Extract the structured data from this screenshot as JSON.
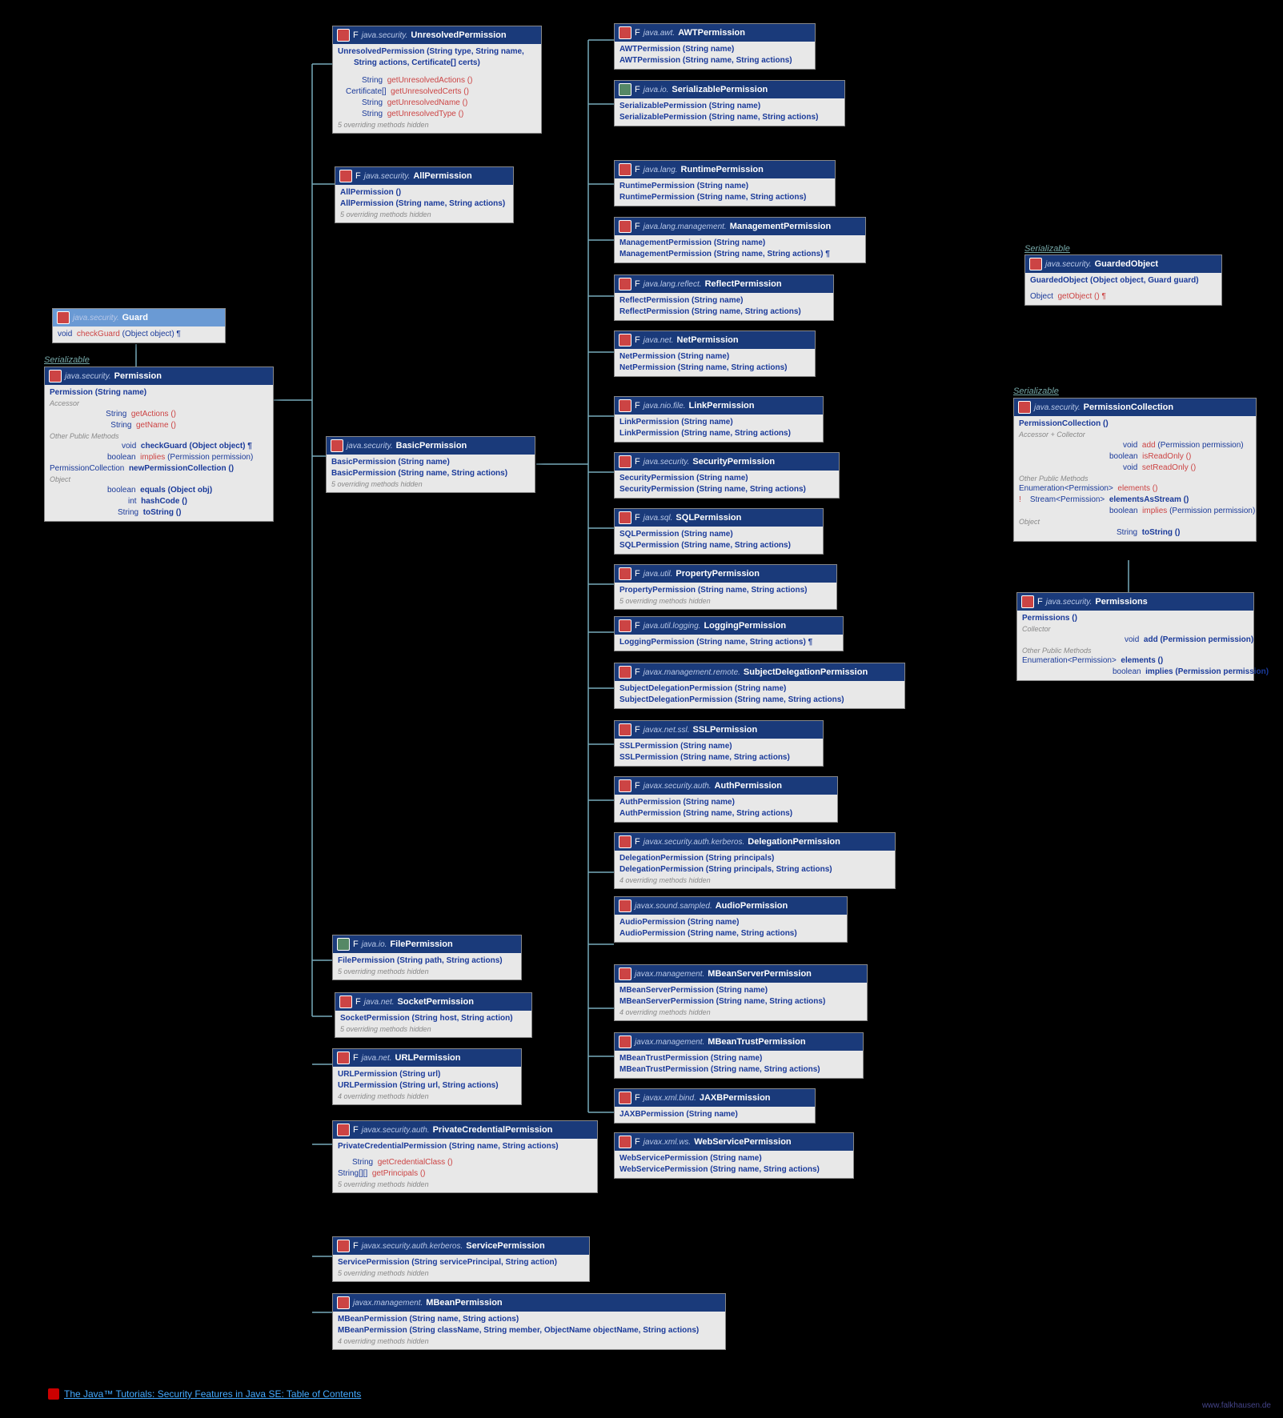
{
  "labels": {
    "ser": "Serializable"
  },
  "guard": {
    "pkg": "java.security.",
    "cls": "Guard",
    "m1": "void",
    "m1n": "checkGuard",
    "m1a": "(Object object) ¶"
  },
  "perm": {
    "pkg": "java.security.",
    "cls": "Permission",
    "c1": "Permission (String name)",
    "acc": "Accessor",
    "r1t": "String",
    "r1n": "getActions ()",
    "r2t": "String",
    "r2n": "getName ()",
    "opm": "Other Public Methods",
    "r3t": "void",
    "r3n": "checkGuard (Object object) ¶",
    "r4t": "boolean",
    "r4n": "implies",
    "r4a": "(Permission permission)",
    "r5t": "PermissionCollection",
    "r5n": "newPermissionCollection ()",
    "obj": "Object",
    "r6t": "boolean",
    "r6n": "equals (Object obj)",
    "r7t": "int",
    "r7n": "hashCode ()",
    "r8t": "String",
    "r8n": "toString ()"
  },
  "unres": {
    "pkg": "java.security.",
    "cls": "UnresolvedPermission",
    "c1": "UnresolvedPermission (String type, String name,",
    "c2": "String actions, Certificate[] certs)",
    "r1t": "String",
    "r1n": "getUnresolvedActions ()",
    "r2t": "Certificate[]",
    "r2n": "getUnresolvedCerts ()",
    "r3t": "String",
    "r3n": "getUnresolvedName ()",
    "r4t": "String",
    "r4n": "getUnresolvedType ()",
    "h": "5 overriding methods hidden"
  },
  "allp": {
    "pkg": "java.security.",
    "cls": "AllPermission",
    "c1": "AllPermission ()",
    "c2": "AllPermission (String name, String actions)",
    "h": "5 overriding methods hidden"
  },
  "basic": {
    "pkg": "java.security.",
    "cls": "BasicPermission",
    "c1": "BasicPermission (String name)",
    "c2": "BasicPermission (String name, String actions)",
    "h": "5 overriding methods hidden"
  },
  "filep": {
    "pkg": "java.io.",
    "cls": "FilePermission",
    "c1": "FilePermission (String path, String actions)",
    "h": "5 overriding methods hidden"
  },
  "sockp": {
    "pkg": "java.net.",
    "cls": "SocketPermission",
    "c1": "SocketPermission (String host, String action)",
    "h": "5 overriding methods hidden"
  },
  "urlp": {
    "pkg": "java.net.",
    "cls": "URLPermission",
    "c1": "URLPermission (String url)",
    "c2": "URLPermission (String url, String actions)",
    "h": "4 overriding methods hidden"
  },
  "privp": {
    "pkg": "javax.security.auth.",
    "cls": "PrivateCredentialPermission",
    "c1": "PrivateCredentialPermission (String name, String actions)",
    "r1t": "String",
    "r1n": "getCredentialClass ()",
    "r2t": "String[][]",
    "r2n": "getPrincipals ()",
    "h": "5 overriding methods hidden"
  },
  "servp": {
    "pkg": "javax.security.auth.kerberos.",
    "cls": "ServicePermission",
    "c1": "ServicePermission (String servicePrincipal, String action)",
    "h": "5 overriding methods hidden"
  },
  "mbeanp": {
    "pkg": "javax.management.",
    "cls": "MBeanPermission",
    "c1": "MBeanPermission (String name, String actions)",
    "c2": "MBeanPermission (String className, String member, ObjectName objectName, String actions)",
    "h": "4 overriding methods hidden"
  },
  "awt": {
    "pkg": "java.awt.",
    "cls": "AWTPermission",
    "c1": "AWTPermission (String name)",
    "c2": "AWTPermission (String name, String actions)"
  },
  "serp": {
    "pkg": "java.io.",
    "cls": "SerializablePermission",
    "c1": "SerializablePermission (String name)",
    "c2": "SerializablePermission (String name, String actions)"
  },
  "runp": {
    "pkg": "java.lang.",
    "cls": "RuntimePermission",
    "c1": "RuntimePermission (String name)",
    "c2": "RuntimePermission (String name, String actions)"
  },
  "mgmtp": {
    "pkg": "java.lang.management.",
    "cls": "ManagementPermission",
    "c1": "ManagementPermission (String name)",
    "c2": "ManagementPermission (String name, String actions) ¶"
  },
  "reflp": {
    "pkg": "java.lang.reflect.",
    "cls": "ReflectPermission",
    "c1": "ReflectPermission (String name)",
    "c2": "ReflectPermission (String name, String actions)"
  },
  "netp": {
    "pkg": "java.net.",
    "cls": "NetPermission",
    "c1": "NetPermission (String name)",
    "c2": "NetPermission (String name, String actions)"
  },
  "linkp": {
    "pkg": "java.nio.file.",
    "cls": "LinkPermission",
    "c1": "LinkPermission (String name)",
    "c2": "LinkPermission (String name, String actions)"
  },
  "secp": {
    "pkg": "java.security.",
    "cls": "SecurityPermission",
    "c1": "SecurityPermission (String name)",
    "c2": "SecurityPermission (String name, String actions)"
  },
  "sqlp": {
    "pkg": "java.sql.",
    "cls": "SQLPermission",
    "c1": "SQLPermission (String name)",
    "c2": "SQLPermission (String name, String actions)"
  },
  "propp": {
    "pkg": "java.util.",
    "cls": "PropertyPermission",
    "c1": "PropertyPermission (String name, String actions)",
    "h": "5 overriding methods hidden"
  },
  "logp": {
    "pkg": "java.util.logging.",
    "cls": "LoggingPermission",
    "c1": "LoggingPermission (String name, String actions) ¶"
  },
  "subjp": {
    "pkg": "javax.management.remote.",
    "cls": "SubjectDelegationPermission",
    "c1": "SubjectDelegationPermission (String name)",
    "c2": "SubjectDelegationPermission (String name, String actions)"
  },
  "sslp": {
    "pkg": "javax.net.ssl.",
    "cls": "SSLPermission",
    "c1": "SSLPermission (String name)",
    "c2": "SSLPermission (String name, String actions)"
  },
  "authp": {
    "pkg": "javax.security.auth.",
    "cls": "AuthPermission",
    "c1": "AuthPermission (String name)",
    "c2": "AuthPermission (String name, String actions)"
  },
  "delegp": {
    "pkg": "javax.security.auth.kerberos.",
    "cls": "DelegationPermission",
    "c1": "DelegationPermission (String principals)",
    "c2": "DelegationPermission (String principals, String actions)",
    "h": "4 overriding methods hidden"
  },
  "audp": {
    "pkg": "javax.sound.sampled.",
    "cls": "AudioPermission",
    "c1": "AudioPermission (String name)",
    "c2": "AudioPermission (String name, String actions)"
  },
  "mbsp": {
    "pkg": "javax.management.",
    "cls": "MBeanServerPermission",
    "c1": "MBeanServerPermission (String name)",
    "c2": "MBeanServerPermission (String name, String actions)",
    "h": "4 overriding methods hidden"
  },
  "mbtp": {
    "pkg": "javax.management.",
    "cls": "MBeanTrustPermission",
    "c1": "MBeanTrustPermission (String name)",
    "c2": "MBeanTrustPermission (String name, String actions)"
  },
  "jaxbp": {
    "pkg": "javax.xml.bind.",
    "cls": "JAXBPermission",
    "c1": "JAXBPermission (String name)"
  },
  "wsp": {
    "pkg": "javax.xml.ws.",
    "cls": "WebServicePermission",
    "c1": "WebServicePermission (String name)",
    "c2": "WebServicePermission (String name, String actions)"
  },
  "gobj": {
    "pkg": "java.security.",
    "cls": "GuardedObject",
    "c1": "GuardedObject (Object object, Guard guard)",
    "r1t": "Object",
    "r1n": "getObject () ¶"
  },
  "pcoll": {
    "pkg": "java.security.",
    "cls": "PermissionCollection",
    "c1": "PermissionCollection ()",
    "acc": "Accessor + Collector",
    "r1t": "void",
    "r1n": "add",
    "r1a": "(Permission permission)",
    "r2t": "boolean",
    "r2n": "isReadOnly ()",
    "r3t": "void",
    "r3n": "setReadOnly ()",
    "opm": "Other Public Methods",
    "r4t": "Enumeration<Permission>",
    "r4n": "elements ()",
    "r5t": "Stream<Permission>",
    "r5n": "elementsAsStream ()",
    "r6t": "boolean",
    "r6n": "implies",
    "r6a": "(Permission permission)",
    "obj": "Object",
    "r7t": "String",
    "r7n": "toString ()"
  },
  "perms": {
    "pkg": "java.security.",
    "cls": "Permissions",
    "c1": "Permissions ()",
    "col": "Collector",
    "r1t": "void",
    "r1n": "add (Permission permission)",
    "opm": "Other Public Methods",
    "r2t": "Enumeration<Permission>",
    "r2n": "elements ()",
    "r3t": "boolean",
    "r3n": "implies (Permission permission)"
  },
  "footlink": "The Java™ Tutorials: Security Features in Java SE: Table of Contents",
  "wm": "www.falkhausen.de"
}
